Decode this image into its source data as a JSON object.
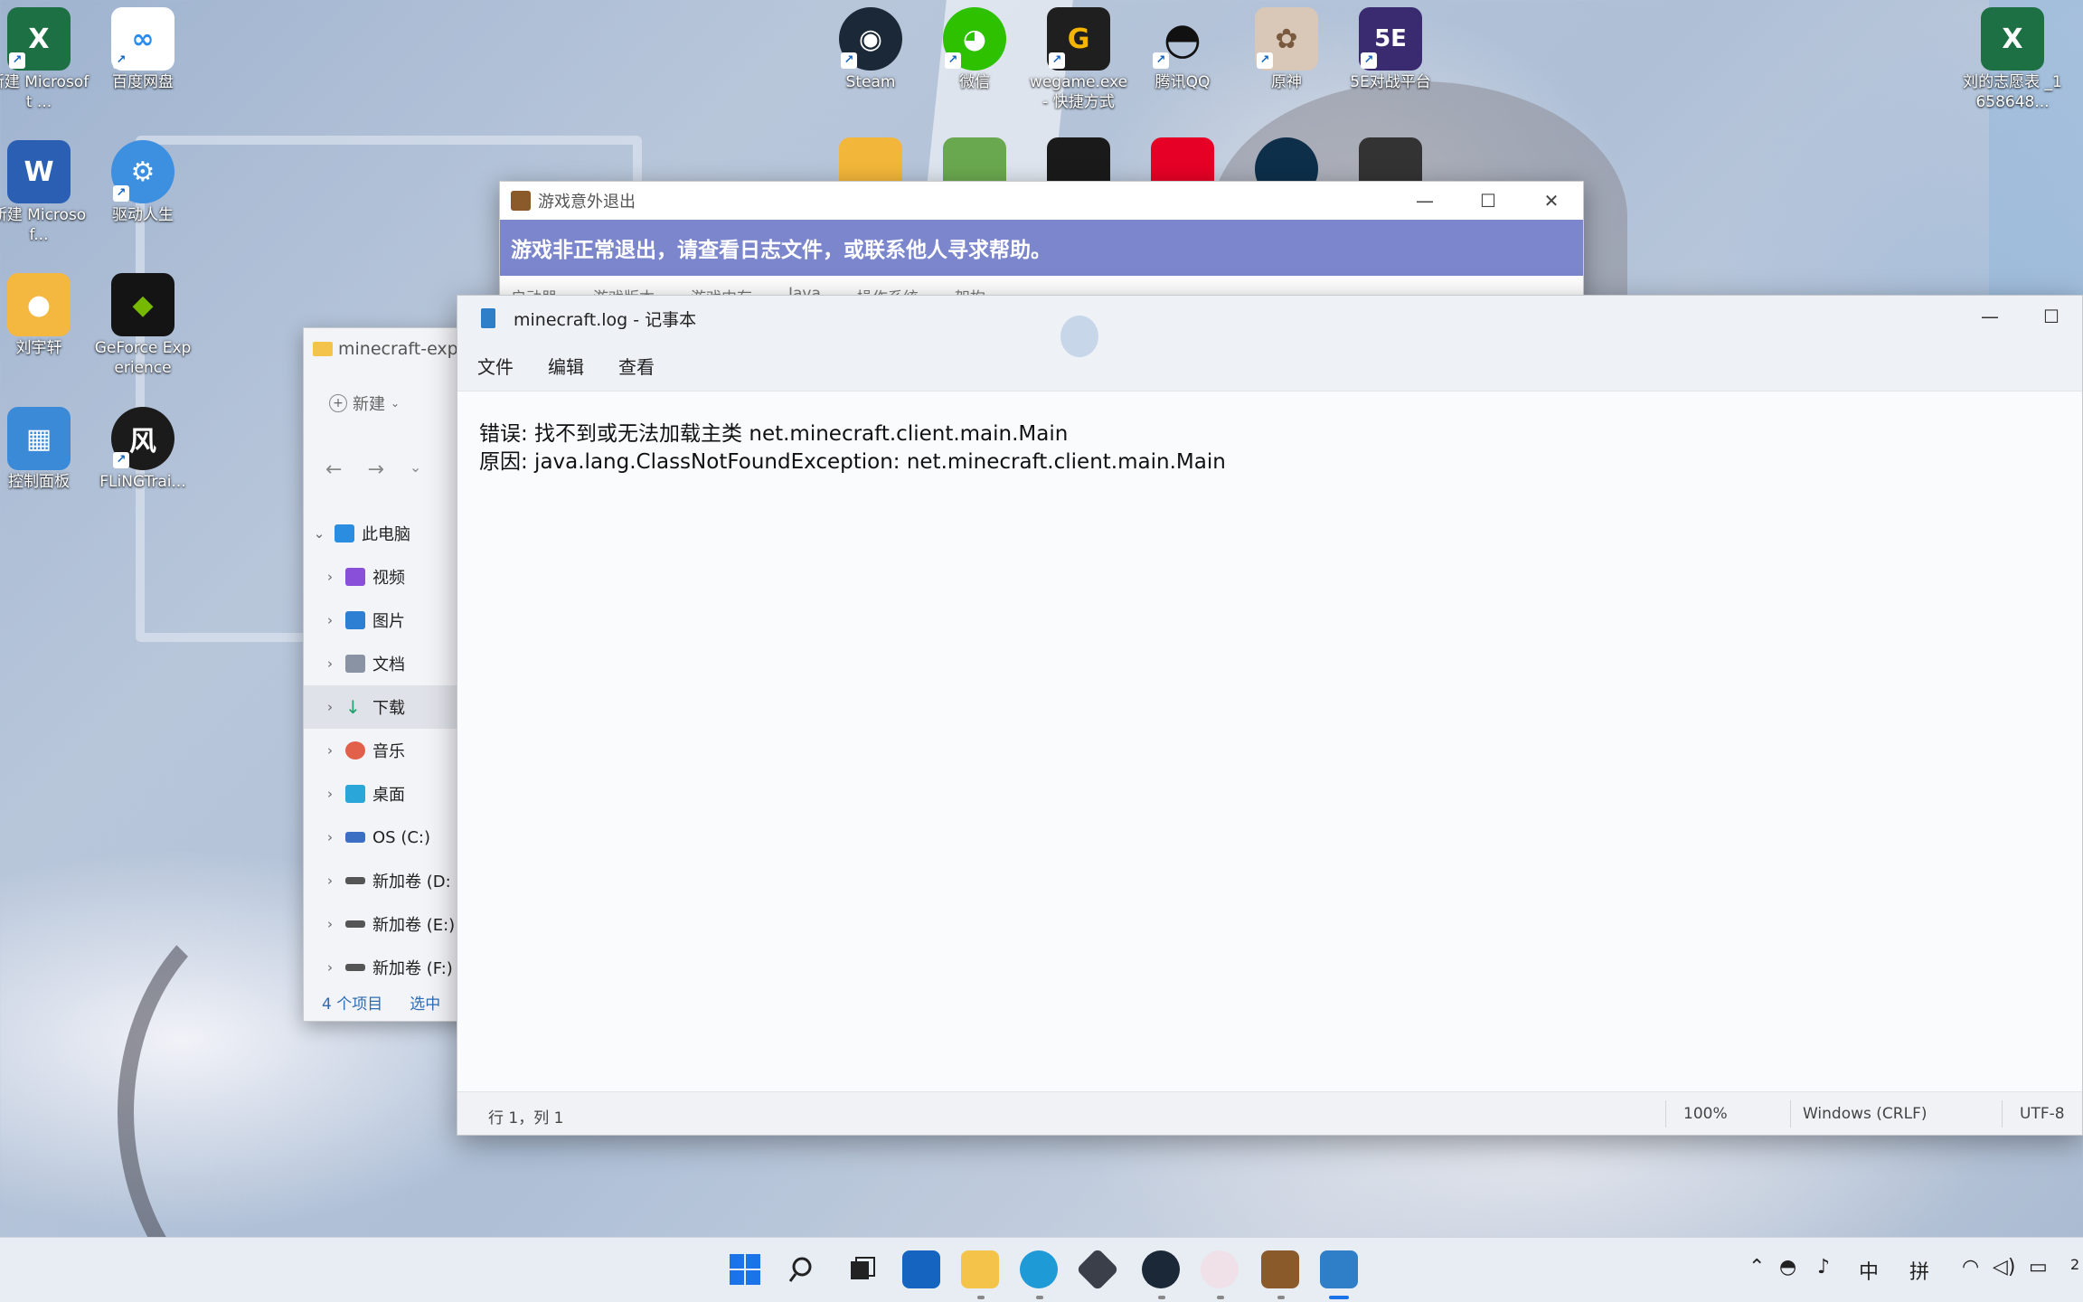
{
  "desktop": {
    "icons": [
      {
        "label": "新建 Microsoft ...",
        "glyph": "X",
        "color": "#1d7044"
      },
      {
        "label": "百度网盘",
        "glyph": "∞",
        "color": "#2a8cf0"
      },
      {
        "label": "新建 Microsof...",
        "glyph": "W",
        "color": "#2b5fb4"
      },
      {
        "label": "驱动人生",
        "glyph": "⚙",
        "color": "#3d8fe0"
      },
      {
        "label": "刘宇轩",
        "glyph": "●",
        "color": "#f4b740"
      },
      {
        "label": "GeForce Experience",
        "glyph": "◆",
        "color": "#141414"
      },
      {
        "label": "控制面板",
        "glyph": "▦",
        "color": "#3b8ad8"
      },
      {
        "label": "FLiNGTrai...",
        "glyph": "风",
        "color": "#1b1b1b"
      },
      {
        "label": "Steam",
        "glyph": "◉",
        "color": "#1b2838"
      },
      {
        "label": "微信",
        "glyph": "◕",
        "color": "#2dc100"
      },
      {
        "label": "wegame.exe - 快捷方式",
        "glyph": "G",
        "color": "#1f1f1f"
      },
      {
        "label": "腾讯QQ",
        "glyph": "◓",
        "color": "#111111"
      },
      {
        "label": "原神",
        "glyph": "✿",
        "color": "#d9c7b8"
      },
      {
        "label": "5E对战平台",
        "glyph": "5E",
        "color": "#3a2a70"
      },
      {
        "label": "刘的志愿表 _1658648...",
        "glyph": "X",
        "color": "#1d7044"
      }
    ]
  },
  "crash_dialog": {
    "title": "游戏意外退出",
    "message": "游戏非正常退出，请查看日志文件，或联系他人寻求帮助。",
    "tabs": [
      "启动器",
      "游戏版本",
      "游戏内存",
      "Java",
      "操作系统",
      "架构"
    ],
    "colors": {
      "banner": "#7b86cc"
    }
  },
  "explorer": {
    "title": "minecraft-expo",
    "new_label": "新建",
    "tree": [
      {
        "label": "此电脑",
        "icon": "computer-icon",
        "color": "#2b8de0"
      },
      {
        "label": "视频",
        "icon": "video-icon",
        "color": "#8a4fd8"
      },
      {
        "label": "图片",
        "icon": "image-icon",
        "color": "#2d7fd3"
      },
      {
        "label": "文档",
        "icon": "document-icon",
        "color": "#8a93a3"
      },
      {
        "label": "下载",
        "icon": "download-icon",
        "color": "#1ea36b"
      },
      {
        "label": "音乐",
        "icon": "music-icon",
        "color": "#e2604a"
      },
      {
        "label": "桌面",
        "icon": "desktop-icon",
        "color": "#2aa6d8"
      },
      {
        "label": "OS (C:)",
        "icon": "drive-icon",
        "color": "#3a6fc4"
      },
      {
        "label": "新加卷 (D:",
        "icon": "drive-icon",
        "color": "#555555"
      },
      {
        "label": "新加卷 (E:)",
        "icon": "drive-icon",
        "color": "#555555"
      },
      {
        "label": "新加卷 (F:)",
        "icon": "drive-icon",
        "color": "#555555"
      }
    ],
    "status_items": "4 个项目",
    "status_selected": "选中"
  },
  "notepad": {
    "title": "minecraft.log - 记事本",
    "menu": [
      "文件",
      "编辑",
      "查看"
    ],
    "lines": [
      "错误: 找不到或无法加载主类 net.minecraft.client.main.Main",
      "原因: java.lang.ClassNotFoundException: net.minecraft.client.main.Main"
    ],
    "status": {
      "position": "行 1，列 1",
      "zoom": "100%",
      "line_ending": "Windows (CRLF)",
      "encoding": "UTF-8"
    }
  },
  "taskbar": {
    "tray": {
      "ime_lang": "中",
      "ime_mode": "拼",
      "clock_partial": "2"
    }
  }
}
